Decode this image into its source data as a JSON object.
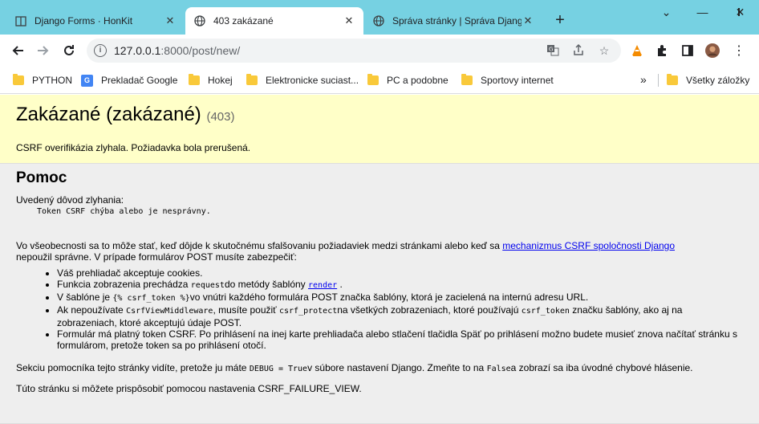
{
  "tabs": [
    {
      "title": "Django Forms · HonKit",
      "icon": "book-icon"
    },
    {
      "title": "403 zakázané",
      "icon": "globe-icon"
    },
    {
      "title": "Správa stránky | Správa Djang",
      "icon": "globe-icon"
    }
  ],
  "new_tab": "+",
  "url": {
    "host": "127.0.0.1",
    "rest": ":8000/post/new/"
  },
  "bookmarks": [
    {
      "label": "PYTHON",
      "icon": "folder-icon"
    },
    {
      "label": "Prekladač Google",
      "icon": "google-translate-icon"
    },
    {
      "label": "Hokej",
      "icon": "folder-icon"
    },
    {
      "label": "Elektronicke suciast...",
      "icon": "folder-icon"
    },
    {
      "label": "PC a podobne",
      "icon": "folder-icon"
    },
    {
      "label": "Sportovy internet",
      "icon": "folder-icon"
    }
  ],
  "bookmarks_more": "»",
  "all_bookmarks": "Všetky záložky",
  "page": {
    "title": "Zakázané (zakázané)",
    "code": "(403)",
    "message": "CSRF overifikázia zlyhala. Požiadavka bola prerušená.",
    "help_heading": "Pomoc",
    "reason_label": "Uvedený dôvod zlyhania:",
    "reason": "Token CSRF chýba alebo je nesprávny.",
    "general_1": "Vo všeobecnosti sa to môže stať, keď dôjde k skutočnému sfalšovaniu požiadaviek medzi stránkami alebo keď sa",
    "general_link": "mechanizmus CSRF spoločnosti Django",
    "general_2": "nepoužil správne. V prípade formulárov POST musíte zabezpečiť:",
    "item1": "Váš prehliadač akceptuje cookies.",
    "item2_a": "Funkcia zobrazenia prechádza",
    "item2_code": "request",
    "item2_b": "do metódy šablóny",
    "item2_link": "render",
    "item2_c": ".",
    "item3_a": "V šablóne je",
    "item3_code": "{% csrf_token %}",
    "item3_b": "vo vnútri každého formulára POST značka šablóny, ktorá je zacielená na internú adresu URL.",
    "item4_a": "Ak nepoužívate",
    "item4_code1": "CsrfViewMiddleware",
    "item4_b": ", musíte použiť",
    "item4_code2": "csrf_protect",
    "item4_c": "na všetkých zobrazeniach, ktoré používajú",
    "item4_code3": "csrf_token",
    "item4_d": "značku šablóny, ako aj na zobrazeniach, ktoré akceptujú údaje POST.",
    "item5": "Formulár má platný token CSRF. Po prihlásení na inej karte prehliadača alebo stlačení tlačidla Späť po prihlásení možno budete musieť znova načítať stránku s formulárom, pretože token sa po prihlásení otočí.",
    "debug_a": "Sekciu pomocníka tejto stránky vidíte, pretože ju máte",
    "debug_code": "DEBUG = True",
    "debug_b": "v súbore nastavení Django. Zmeňte to na",
    "debug_code2": "False",
    "debug_c": "a zobrazí sa iba úvodné chybové hlásenie.",
    "custom": "Túto stránku si môžete prispôsobiť pomocou nastavenia CSRF_FAILURE_VIEW."
  }
}
